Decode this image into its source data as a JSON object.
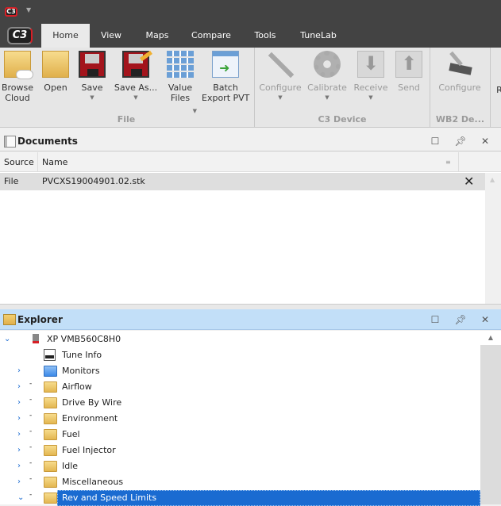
{
  "app": {
    "logo": "C3",
    "accent": "#d61f26"
  },
  "tabs": [
    {
      "label": "Home",
      "active": true
    },
    {
      "label": "View"
    },
    {
      "label": "Maps"
    },
    {
      "label": "Compare"
    },
    {
      "label": "Tools"
    },
    {
      "label": "TuneLab"
    }
  ],
  "ribbon": {
    "file": {
      "label": "File",
      "buttons": [
        {
          "label": "Browse\nCloud"
        },
        {
          "label": "Open"
        },
        {
          "label": "Save"
        },
        {
          "label": "Save As..."
        },
        {
          "label": "Value\nFiles"
        },
        {
          "label": "Batch\nExport PVT"
        }
      ]
    },
    "c3": {
      "label": "C3 Device",
      "buttons": [
        {
          "label": "Configure"
        },
        {
          "label": "Calibrate"
        },
        {
          "label": "Receive"
        },
        {
          "label": "Send"
        }
      ]
    },
    "wb2": {
      "label": "WB2 De...",
      "buttons": [
        {
          "label": "Configure"
        }
      ]
    },
    "cut": "R"
  },
  "documents": {
    "title": "Documents",
    "columns": [
      "Source",
      "Name"
    ],
    "rows": [
      {
        "source": "File",
        "name": "PVCXS19004901.02.stk"
      }
    ]
  },
  "explorer": {
    "title": "Explorer",
    "root": "XP VMB560C8H0",
    "items": [
      {
        "label": "Tune Info",
        "type": "info"
      },
      {
        "label": "Monitors",
        "type": "blue"
      },
      {
        "label": "Airflow"
      },
      {
        "label": "Drive By Wire"
      },
      {
        "label": "Environment"
      },
      {
        "label": "Fuel"
      },
      {
        "label": "Fuel Injector"
      },
      {
        "label": "Idle"
      },
      {
        "label": "Miscellaneous"
      },
      {
        "label": "Rev and Speed Limits",
        "selected": true
      }
    ]
  }
}
